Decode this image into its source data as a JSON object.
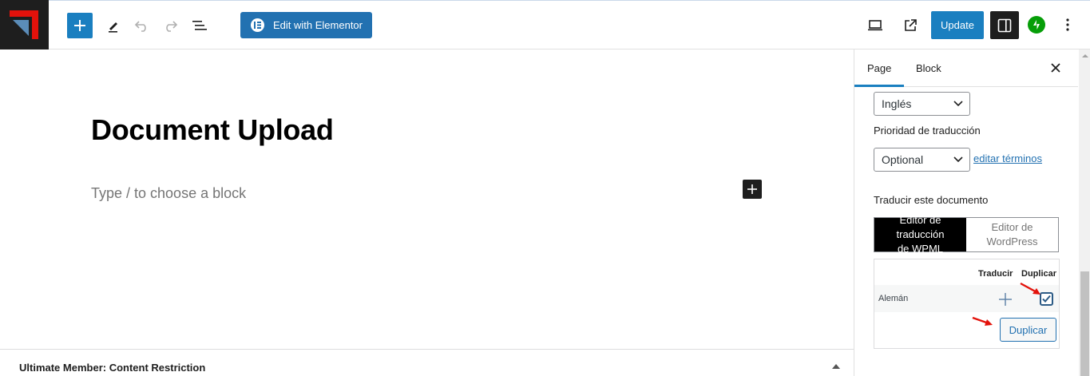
{
  "toolbar": {
    "elementor_label": "Edit with Elementor",
    "update_label": "Update"
  },
  "editor": {
    "title": "Document Upload",
    "placeholder": "Type / to choose a block"
  },
  "meta_box": {
    "title": "Ultimate Member: Content Restriction"
  },
  "sidebar": {
    "tabs": [
      {
        "label": "Page",
        "active": true
      },
      {
        "label": "Block",
        "active": false
      }
    ],
    "language_select": "Inglés",
    "priority_label": "Prioridad de traducción",
    "priority_select": "Optional",
    "edit_terms_link": "editar términos",
    "translate_heading": "Traducir este documento",
    "editor_options": {
      "wpml_line1": "Editor de traducción",
      "wpml_line2": "de WPML",
      "wp_line1": "Editor de",
      "wp_line2": "WordPress"
    },
    "translation_table": {
      "col_translate": "Traducir",
      "col_duplicate": "Duplicar",
      "row_language": "Alemán",
      "duplicate_checked": true,
      "duplicate_button": "Duplicar"
    }
  },
  "colors": {
    "primary": "#1a7fc0",
    "elementor": "#2271b1",
    "dark": "#1e1e1e",
    "jetpack": "#069e08",
    "annotation_arrow": "#e3120b"
  }
}
